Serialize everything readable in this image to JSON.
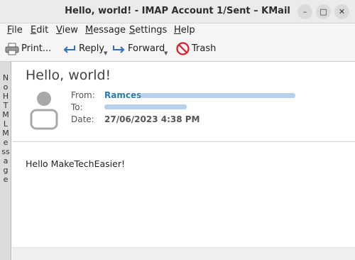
{
  "window": {
    "title": "Hello, world! - IMAP Account 1/Sent – KMail",
    "minimize_glyph": "–",
    "maximize_glyph": "□",
    "close_glyph": "✕"
  },
  "menu": {
    "items": [
      {
        "mnemonic": "F",
        "rest": "ile"
      },
      {
        "mnemonic": "E",
        "rest": "dit"
      },
      {
        "mnemonic": "V",
        "rest": "iew"
      },
      {
        "mnemonic": "M",
        "rest": "essage"
      },
      {
        "mnemonic": "S",
        "rest": "ettings"
      },
      {
        "mnemonic": "H",
        "rest": "elp"
      }
    ]
  },
  "toolbar": {
    "print_label": "Print...",
    "reply_label": "Reply",
    "forward_label": "Forward",
    "trash_label": "Trash",
    "dropdown_glyph": "▼"
  },
  "banner": {
    "text": "No HTML Message"
  },
  "message": {
    "subject": "Hello, world!",
    "from_label": "From:",
    "from_name": "Ramces",
    "to_label": "To:",
    "date_label": "Date:",
    "date_value": "27/06/2023 4:38 PM",
    "body": "Hello MakeTechEasier!"
  },
  "colors": {
    "link": "#2a7ab0",
    "reply_arrow": "#2e6fc2",
    "trash_red": "#d81b2b"
  }
}
